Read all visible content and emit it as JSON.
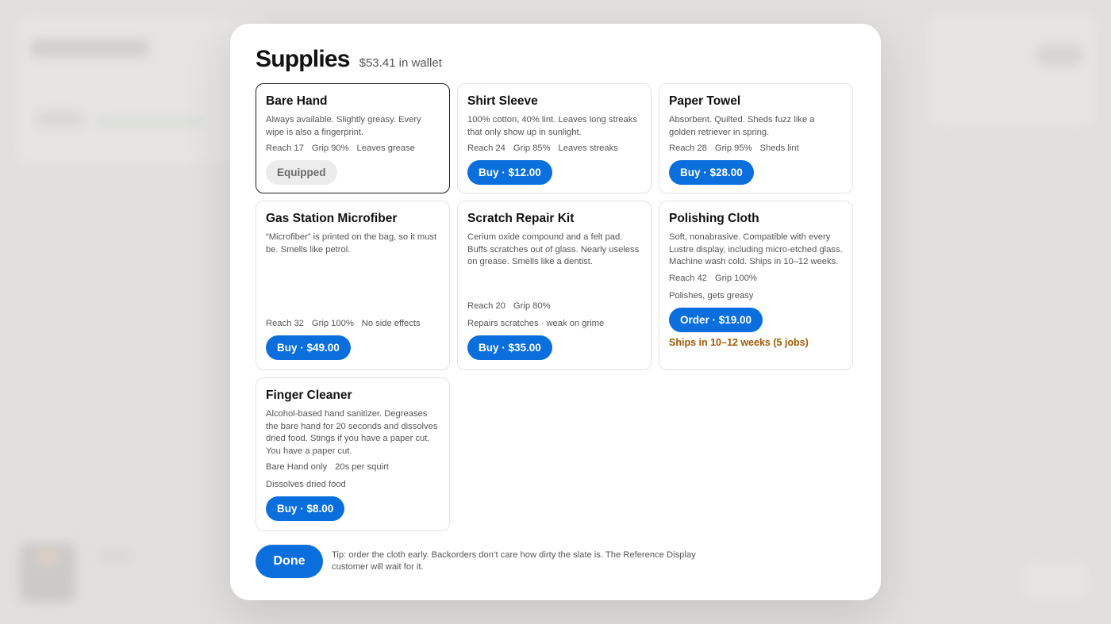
{
  "modal": {
    "title": "Supplies",
    "wallet": "$53.41 in wallet"
  },
  "items": [
    {
      "name": "Bare Hand",
      "desc": "Always available. Slightly greasy. Every wipe is also a fingerprint.",
      "stats": [
        "Reach 17",
        "Grip 90%",
        "Leaves grease"
      ],
      "extra": "",
      "button": "Equipped",
      "note": ""
    },
    {
      "name": "Shirt Sleeve",
      "desc": "100% cotton, 40% lint. Leaves long streaks that only show up in sunlight.",
      "stats": [
        "Reach 24",
        "Grip 85%",
        "Leaves streaks"
      ],
      "extra": "",
      "button": "Buy · $12.00",
      "note": ""
    },
    {
      "name": "Paper Towel",
      "desc": "Absorbent. Quilted. Sheds fuzz like a golden retriever in spring.",
      "stats": [
        "Reach 28",
        "Grip 95%",
        "Sheds lint"
      ],
      "extra": "",
      "button": "Buy · $28.00",
      "note": ""
    },
    {
      "name": "Gas Station Microfiber",
      "desc": "“Microfiber” is printed on the bag, so it must be. Smells like petrol.",
      "stats": [
        "Reach 32",
        "Grip 100%",
        "No side effects"
      ],
      "extra": "",
      "button": "Buy · $49.00",
      "note": ""
    },
    {
      "name": "Scratch Repair Kit",
      "desc": "Cerium oxide compound and a felt pad. Buffs scratches out of glass. Nearly useless on grease. Smells like a dentist.",
      "stats": [
        "Reach 20",
        "Grip 80%"
      ],
      "extra": "Repairs scratches · weak on grime",
      "button": "Buy · $35.00",
      "note": ""
    },
    {
      "name": "Polishing Cloth",
      "desc": "Soft, nonabrasive. Compatible with every Lustre display, including micro-etched glass. Machine wash cold. Ships in 10–12 weeks.",
      "stats": [
        "Reach 42",
        "Grip 100%"
      ],
      "extra": "Polishes, gets greasy",
      "button": "Order · $19.00",
      "note": "Ships in 10–12 weeks (5 jobs)"
    },
    {
      "name": "Finger Cleaner",
      "desc": "Alcohol-based hand sanitizer. Degreases the bare hand for 20 seconds and dissolves dried food. Stings if you have a paper cut. You have a paper cut.",
      "stats": [
        "Bare Hand only",
        "20s per squirt"
      ],
      "extra": "Dissolves dried food",
      "button": "Buy · $8.00",
      "note": ""
    }
  ],
  "footer": {
    "done": "Done",
    "tip": "Tip: order the cloth early. Backorders don’t care how dirty the slate is. The Reference Display customer will wait for it."
  },
  "colors": {
    "accent": "#0a6fdc",
    "note": "#a05a00"
  }
}
